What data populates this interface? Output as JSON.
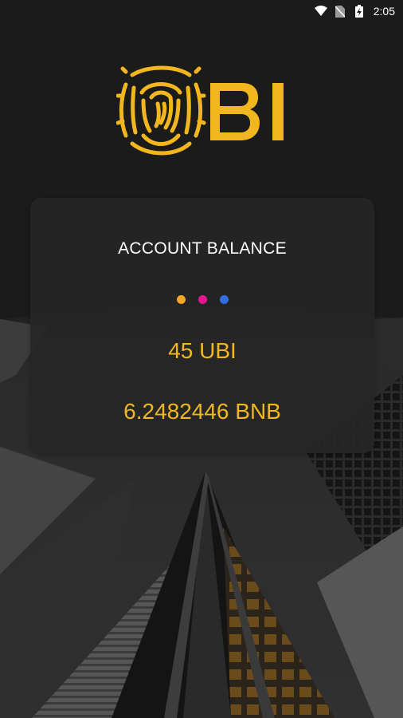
{
  "status_bar": {
    "time": "2:05",
    "icons": [
      "wifi-icon",
      "no-sim-icon",
      "battery-charging-icon"
    ]
  },
  "logo": {
    "text": "UBI",
    "icon": "fingerprint-icon",
    "color": "#f2b71e"
  },
  "balance_card": {
    "title": "ACCOUNT BALANCE",
    "dots": [
      {
        "name": "orange-dot",
        "color": "#f5a623"
      },
      {
        "name": "pink-dot",
        "color": "#e9158c"
      },
      {
        "name": "blue-dot",
        "color": "#2f6fe0"
      }
    ],
    "ubi_balance": "45 UBI",
    "bnb_balance": "6.2482446 BNB"
  },
  "theme": {
    "accent": "#f2b71e",
    "background": "#1b1b1b",
    "card": "#262626"
  }
}
